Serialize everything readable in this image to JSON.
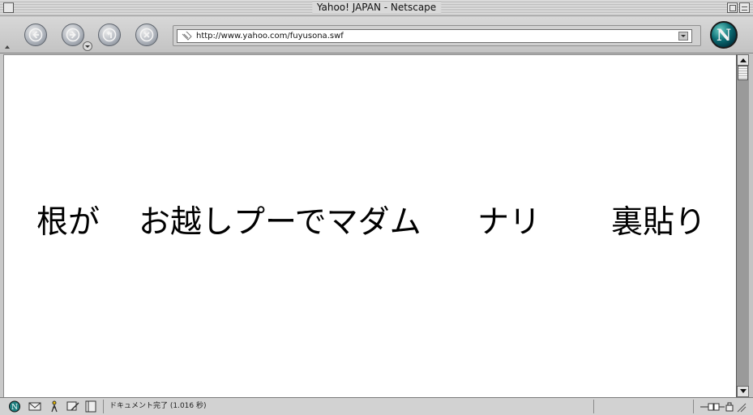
{
  "window": {
    "title": "Yahoo! JAPAN - Netscape"
  },
  "toolbar": {
    "back_icon": "back-arrow-icon",
    "forward_icon": "forward-arrow-icon",
    "reload_icon": "reload-icon",
    "stop_icon": "stop-icon",
    "url": "http://www.yahoo.com/fuyusona.swf",
    "logo_letter": "N"
  },
  "content": {
    "segments": [
      "根が",
      "お越しプーでマダム",
      "ナリ",
      "裏貼り"
    ]
  },
  "statusbar": {
    "text": "ドキュメント完了 (1.016 秒)",
    "icons": [
      "netscape-icon",
      "mail-icon",
      "aim-icon",
      "composer-icon",
      "address-book-icon"
    ]
  },
  "colors": {
    "page_bg": "#ffffff",
    "chrome": "#c9c9c9",
    "logo": "#0a6c73"
  }
}
